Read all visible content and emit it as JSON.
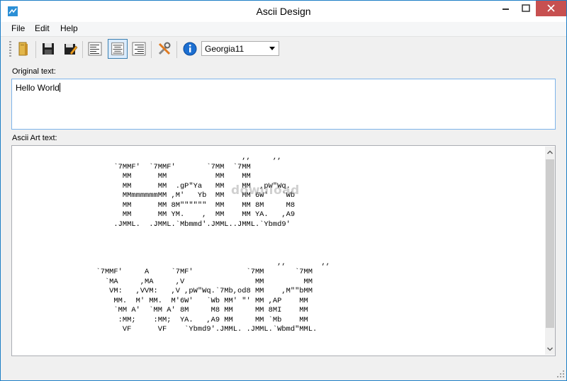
{
  "window": {
    "title": "Ascii Design"
  },
  "menu": {
    "file": "File",
    "edit": "Edit",
    "help": "Help"
  },
  "toolbar": {
    "buttons": [
      {
        "name": "open-book-icon"
      },
      {
        "name": "save-icon"
      },
      {
        "name": "save-as-icon"
      },
      {
        "name": "align-left-icon"
      },
      {
        "name": "align-center-icon",
        "active": true
      },
      {
        "name": "align-right-icon"
      },
      {
        "name": "settings-tools-icon"
      },
      {
        "name": "info-icon"
      }
    ],
    "font_value": "Georgia11"
  },
  "original": {
    "label": "Original text:",
    "value": "Hello World"
  },
  "ascii": {
    "label": "Ascii Art text:",
    "lines": [
      "                                                    ,,     ,,",
      "                       `7MMF'  `7MMF'       `7MM  `7MM",
      "                         MM      MM           MM    MM",
      "                         MM      MM  .gP\"Ya   MM    MM  ,pW\"Wq.",
      "                         MMmmmmmmMM ,M'   Yb  MM    MM 6W'   `Wb",
      "                         MM      MM 8M\"\"\"\"\"\"  MM    MM 8M     M8",
      "                         MM      MM YM.    ,  MM    MM YA.   ,A9",
      "                       .JMML.  .JMML.`Mbmmd'.JMML..JMML.`Ybmd9'",
      "",
      "",
      "",
      "                                                            ,,        ,,",
      "                   `7MMF'     A     `7MF'            `7MM       `7MM",
      "                     `MA     ,MA     ,V                MM         MM",
      "                      VM:   ,VVM:   ,V ,pW\"Wq.`7Mb,od8 MM    ,M\"\"bMM",
      "                       MM.  M' MM.  M'6W'   `Wb MM' \"' MM ,AP    MM",
      "                       `MM A'  `MM A' 8M     M8 MM     MM 8MI    MM",
      "                        :MM;    :MM;  YA.   ,A9 MM     MM `Mb    MM",
      "                         VF      VF    `Ybmd9'.JMML. .JMML.`Wbmd\"MML."
    ]
  },
  "watermark": "dowuload",
  "colors": {
    "window_border": "#1e7fc6",
    "close_button": "#c75050",
    "focus_border": "#7eb4ea",
    "info_blue": "#1c6fd1"
  }
}
